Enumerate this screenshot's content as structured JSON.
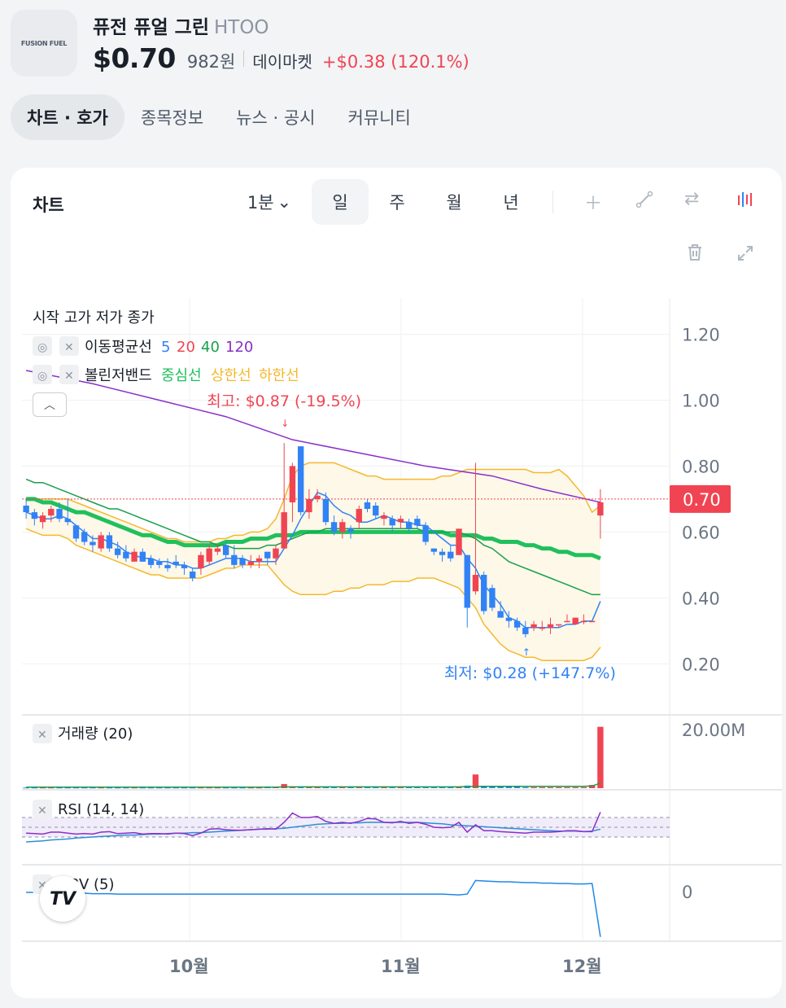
{
  "header": {
    "logo_text": "FUSION FUEL",
    "name": "퓨전 퓨얼 그린",
    "ticker": "HTOO",
    "price": "$0.70",
    "price_krw": "982원",
    "market": "데이마켓",
    "change": "+$0.38 (120.1%)",
    "change_color": "#f04452"
  },
  "tabs": [
    {
      "label": "차트 · 호가",
      "active": true
    },
    {
      "label": "종목정보"
    },
    {
      "label": "뉴스 · 공시"
    },
    {
      "label": "커뮤니티"
    }
  ],
  "chart_panel": {
    "title": "차트",
    "interval": "1분",
    "periods": [
      "일",
      "주",
      "월",
      "년"
    ],
    "active_period": "일",
    "tools": [
      "plus-icon",
      "line-draw-icon",
      "swap-icon",
      "candle-type-icon",
      "trash-icon",
      "expand-icon"
    ]
  },
  "legend": {
    "ohlc": "시작 고가 저가 종가",
    "ma_label": "이동평균선",
    "ma_periods": [
      "5",
      "20",
      "40",
      "120"
    ],
    "bb_label": "볼린저밴드",
    "bb_center": "중심선",
    "bb_upper": "상한선",
    "bb_lower": "하한선",
    "volume_label": "거래량 (20)",
    "rsi_label": "RSI (14, 14)",
    "obv_label": "OBV (5)"
  },
  "annotations": {
    "high": "최고: $0.87 (-19.5%)",
    "low": "최저: $0.28 (+147.7%)",
    "current_price": "0.70"
  },
  "colors": {
    "up": "#f04452",
    "down": "#3182f6",
    "ma5": "#3182f6",
    "ma20": "#f04452",
    "ma40": "#1a9e4b",
    "ma120": "#8b2fc9",
    "bb_center": "#20c05c",
    "bb_band": "#f5b82e"
  },
  "chart_data": {
    "type": "candlestick",
    "price_axis": {
      "ticks": [
        "1.20",
        "1.00",
        "0.80",
        "0.60",
        "0.40",
        "0.20"
      ],
      "range": [
        0.05,
        1.31
      ]
    },
    "x_axis": {
      "ticks": [
        "10월",
        "11월",
        "12월"
      ]
    },
    "volume_axis": {
      "ticks": [
        "20.00M"
      ]
    },
    "obv_axis": {
      "ticks": [
        "0"
      ]
    },
    "candles": [
      [
        0.68,
        0.7,
        0.64,
        0.66
      ],
      [
        0.66,
        0.67,
        0.62,
        0.64
      ],
      [
        0.63,
        0.66,
        0.61,
        0.65
      ],
      [
        0.65,
        0.68,
        0.63,
        0.67
      ],
      [
        0.67,
        0.69,
        0.63,
        0.64
      ],
      [
        0.64,
        0.7,
        0.62,
        0.63
      ],
      [
        0.62,
        0.62,
        0.57,
        0.58
      ],
      [
        0.6,
        0.61,
        0.56,
        0.57
      ],
      [
        0.57,
        0.59,
        0.54,
        0.56
      ],
      [
        0.55,
        0.6,
        0.54,
        0.59
      ],
      [
        0.59,
        0.6,
        0.54,
        0.55
      ],
      [
        0.55,
        0.57,
        0.52,
        0.53
      ],
      [
        0.54,
        0.56,
        0.51,
        0.52
      ],
      [
        0.51,
        0.55,
        0.51,
        0.54
      ],
      [
        0.54,
        0.55,
        0.51,
        0.51
      ],
      [
        0.52,
        0.53,
        0.49,
        0.5
      ],
      [
        0.51,
        0.52,
        0.49,
        0.5
      ],
      [
        0.5,
        0.52,
        0.48,
        0.49
      ],
      [
        0.51,
        0.53,
        0.49,
        0.5
      ],
      [
        0.5,
        0.51,
        0.47,
        0.49
      ],
      [
        0.48,
        0.49,
        0.45,
        0.46
      ],
      [
        0.49,
        0.54,
        0.47,
        0.53
      ],
      [
        0.51,
        0.56,
        0.5,
        0.55
      ],
      [
        0.54,
        0.56,
        0.53,
        0.55
      ],
      [
        0.56,
        0.57,
        0.52,
        0.53
      ],
      [
        0.53,
        0.56,
        0.49,
        0.5
      ],
      [
        0.52,
        0.53,
        0.49,
        0.5
      ],
      [
        0.5,
        0.53,
        0.49,
        0.51
      ],
      [
        0.51,
        0.53,
        0.49,
        0.52
      ],
      [
        0.54,
        0.54,
        0.5,
        0.52
      ],
      [
        0.52,
        0.56,
        0.5,
        0.55
      ],
      [
        0.55,
        0.87,
        0.55,
        0.66
      ],
      [
        0.69,
        0.81,
        0.63,
        0.8
      ],
      [
        0.86,
        0.86,
        0.65,
        0.66
      ],
      [
        0.66,
        0.73,
        0.64,
        0.7
      ],
      [
        0.7,
        0.73,
        0.69,
        0.71
      ],
      [
        0.7,
        0.72,
        0.62,
        0.63
      ],
      [
        0.63,
        0.65,
        0.59,
        0.6
      ],
      [
        0.6,
        0.64,
        0.58,
        0.63
      ],
      [
        0.61,
        0.62,
        0.58,
        0.6
      ],
      [
        0.63,
        0.68,
        0.61,
        0.67
      ],
      [
        0.69,
        0.7,
        0.66,
        0.67
      ],
      [
        0.68,
        0.69,
        0.64,
        0.65
      ],
      [
        0.64,
        0.66,
        0.62,
        0.65
      ],
      [
        0.64,
        0.65,
        0.6,
        0.62
      ],
      [
        0.63,
        0.65,
        0.61,
        0.64
      ],
      [
        0.63,
        0.64,
        0.6,
        0.61
      ],
      [
        0.64,
        0.65,
        0.61,
        0.62
      ],
      [
        0.62,
        0.63,
        0.56,
        0.57
      ],
      [
        0.55,
        0.55,
        0.53,
        0.54
      ],
      [
        0.54,
        0.55,
        0.51,
        0.53
      ],
      [
        0.54,
        0.56,
        0.51,
        0.52
      ],
      [
        0.53,
        0.61,
        0.53,
        0.61
      ],
      [
        0.53,
        0.53,
        0.31,
        0.37
      ],
      [
        0.42,
        0.81,
        0.41,
        0.47
      ],
      [
        0.47,
        0.48,
        0.35,
        0.36
      ],
      [
        0.43,
        0.44,
        0.36,
        0.37
      ],
      [
        0.36,
        0.39,
        0.34,
        0.34
      ],
      [
        0.34,
        0.36,
        0.31,
        0.33
      ],
      [
        0.33,
        0.34,
        0.3,
        0.31
      ],
      [
        0.31,
        0.33,
        0.28,
        0.29
      ],
      [
        0.31,
        0.33,
        0.3,
        0.32
      ],
      [
        0.31,
        0.33,
        0.3,
        0.31
      ],
      [
        0.31,
        0.34,
        0.29,
        0.32
      ],
      [
        0.32,
        0.32,
        0.31,
        0.32
      ],
      [
        0.33,
        0.35,
        0.33,
        0.33
      ],
      [
        0.32,
        0.34,
        0.32,
        0.34
      ],
      [
        0.33,
        0.35,
        0.32,
        0.33
      ],
      [
        0.33,
        0.33,
        0.33,
        0.33
      ],
      [
        0.65,
        0.73,
        0.58,
        0.69
      ]
    ],
    "ma5": [
      0.66,
      0.65,
      0.64,
      0.64,
      0.65,
      0.64,
      0.62,
      0.6,
      0.58,
      0.58,
      0.57,
      0.56,
      0.54,
      0.53,
      0.52,
      0.52,
      0.51,
      0.51,
      0.5,
      0.5,
      0.49,
      0.49,
      0.5,
      0.51,
      0.52,
      0.52,
      0.52,
      0.51,
      0.51,
      0.51,
      0.51,
      0.55,
      0.59,
      0.64,
      0.68,
      0.72,
      0.71,
      0.68,
      0.66,
      0.65,
      0.63,
      0.63,
      0.64,
      0.65,
      0.64,
      0.63,
      0.63,
      0.62,
      0.62,
      0.6,
      0.58,
      0.56,
      0.56,
      0.52,
      0.49,
      0.44,
      0.41,
      0.38,
      0.34,
      0.33,
      0.31,
      0.31,
      0.31,
      0.31,
      0.31,
      0.32,
      0.32,
      0.33,
      0.33,
      0.39
    ],
    "ma40": [
      0.76,
      0.75,
      0.75,
      0.74,
      0.73,
      0.72,
      0.71,
      0.7,
      0.69,
      0.68,
      0.67,
      0.67,
      0.66,
      0.65,
      0.64,
      0.63,
      0.62,
      0.61,
      0.6,
      0.59,
      0.58,
      0.57,
      0.57,
      0.56,
      0.56,
      0.55,
      0.55,
      0.55,
      0.55,
      0.56,
      0.56,
      0.57,
      0.58,
      0.59,
      0.6,
      0.6,
      0.61,
      0.61,
      0.61,
      0.61,
      0.61,
      0.61,
      0.61,
      0.61,
      0.61,
      0.61,
      0.61,
      0.61,
      0.6,
      0.6,
      0.6,
      0.6,
      0.6,
      0.59,
      0.58,
      0.56,
      0.55,
      0.53,
      0.51,
      0.5,
      0.49,
      0.48,
      0.47,
      0.46,
      0.45,
      0.44,
      0.43,
      0.42,
      0.41,
      0.41
    ],
    "bb_center": [
      0.7,
      0.7,
      0.69,
      0.69,
      0.68,
      0.67,
      0.66,
      0.66,
      0.65,
      0.64,
      0.63,
      0.62,
      0.61,
      0.6,
      0.59,
      0.59,
      0.58,
      0.57,
      0.57,
      0.56,
      0.56,
      0.56,
      0.56,
      0.56,
      0.57,
      0.57,
      0.57,
      0.58,
      0.58,
      0.58,
      0.59,
      0.59,
      0.59,
      0.6,
      0.6,
      0.6,
      0.6,
      0.6,
      0.6,
      0.6,
      0.6,
      0.6,
      0.6,
      0.6,
      0.6,
      0.6,
      0.6,
      0.6,
      0.6,
      0.6,
      0.6,
      0.59,
      0.59,
      0.59,
      0.59,
      0.58,
      0.58,
      0.57,
      0.57,
      0.57,
      0.56,
      0.56,
      0.55,
      0.55,
      0.54,
      0.54,
      0.53,
      0.53,
      0.53,
      0.52
    ],
    "bb_upper": [
      0.7,
      0.7,
      0.7,
      0.7,
      0.7,
      0.7,
      0.69,
      0.68,
      0.67,
      0.66,
      0.65,
      0.64,
      0.63,
      0.62,
      0.61,
      0.6,
      0.59,
      0.58,
      0.58,
      0.57,
      0.57,
      0.57,
      0.57,
      0.58,
      0.58,
      0.59,
      0.59,
      0.6,
      0.6,
      0.61,
      0.64,
      0.7,
      0.77,
      0.8,
      0.81,
      0.81,
      0.81,
      0.81,
      0.8,
      0.79,
      0.78,
      0.77,
      0.77,
      0.76,
      0.76,
      0.76,
      0.76,
      0.76,
      0.76,
      0.76,
      0.77,
      0.77,
      0.78,
      0.79,
      0.79,
      0.79,
      0.79,
      0.79,
      0.79,
      0.79,
      0.79,
      0.78,
      0.78,
      0.78,
      0.79,
      0.77,
      0.74,
      0.71,
      0.66,
      0.68
    ],
    "bb_lower": [
      0.61,
      0.6,
      0.59,
      0.59,
      0.59,
      0.58,
      0.56,
      0.55,
      0.54,
      0.53,
      0.52,
      0.51,
      0.5,
      0.49,
      0.48,
      0.47,
      0.47,
      0.46,
      0.46,
      0.46,
      0.46,
      0.46,
      0.47,
      0.48,
      0.49,
      0.49,
      0.5,
      0.5,
      0.5,
      0.5,
      0.47,
      0.44,
      0.42,
      0.41,
      0.41,
      0.41,
      0.41,
      0.42,
      0.42,
      0.43,
      0.43,
      0.44,
      0.44,
      0.44,
      0.45,
      0.45,
      0.45,
      0.46,
      0.46,
      0.46,
      0.45,
      0.44,
      0.43,
      0.4,
      0.37,
      0.32,
      0.29,
      0.26,
      0.24,
      0.23,
      0.22,
      0.22,
      0.21,
      0.21,
      0.21,
      0.21,
      0.21,
      0.21,
      0.22,
      0.25
    ],
    "ma120_line": [
      [
        0,
        1.09
      ],
      [
        8,
        1.05
      ],
      [
        16,
        1.0
      ],
      [
        24,
        0.95
      ],
      [
        32,
        0.88
      ],
      [
        40,
        0.84
      ],
      [
        48,
        0.8
      ],
      [
        56,
        0.77
      ],
      [
        62,
        0.73
      ],
      [
        69,
        0.69
      ]
    ],
    "volume_m": [
      0.2,
      0.2,
      0.2,
      0.2,
      0.2,
      0.2,
      0.2,
      0.2,
      0.2,
      0.2,
      0.2,
      0.2,
      0.2,
      0.2,
      0.2,
      0.2,
      0.2,
      0.2,
      0.2,
      0.2,
      0.2,
      0.2,
      0.2,
      0.2,
      0.2,
      0.2,
      0.2,
      0.2,
      0.2,
      0.3,
      0.3,
      1.3,
      0.5,
      0.4,
      0.3,
      0.3,
      0.3,
      0.3,
      0.3,
      0.3,
      0.3,
      0.3,
      0.3,
      0.3,
      0.3,
      0.3,
      0.3,
      0.3,
      0.3,
      0.3,
      0.3,
      0.3,
      0.3,
      0.8,
      4.3,
      0.6,
      0.5,
      0.4,
      0.4,
      0.4,
      0.3,
      0.3,
      0.3,
      0.3,
      0.3,
      0.3,
      0.3,
      0.3,
      1.0,
      19.3
    ],
    "volume_ma": [
      0.3,
      0.3,
      0.3,
      0.3,
      0.3,
      0.3,
      0.3,
      0.3,
      0.3,
      0.3,
      0.3,
      0.3,
      0.3,
      0.3,
      0.3,
      0.3,
      0.3,
      0.3,
      0.3,
      0.3,
      0.3,
      0.3,
      0.3,
      0.3,
      0.3,
      0.3,
      0.3,
      0.3,
      0.3,
      0.3,
      0.3,
      0.4,
      0.4,
      0.4,
      0.4,
      0.4,
      0.4,
      0.4,
      0.4,
      0.4,
      0.4,
      0.4,
      0.4,
      0.4,
      0.4,
      0.4,
      0.4,
      0.4,
      0.4,
      0.4,
      0.4,
      0.4,
      0.4,
      0.5,
      0.6,
      0.6,
      0.6,
      0.6,
      0.6,
      0.6,
      0.6,
      0.6,
      0.6,
      0.6,
      0.6,
      0.6,
      0.6,
      0.6,
      0.7,
      1.6
    ],
    "rsi": [
      38,
      37,
      36,
      40,
      40,
      38,
      36,
      37,
      36,
      40,
      41,
      37,
      38,
      39,
      36,
      37,
      37,
      36,
      38,
      37,
      33,
      38,
      46,
      47,
      45,
      44,
      44,
      45,
      46,
      47,
      46,
      60,
      79,
      70,
      70,
      72,
      62,
      58,
      60,
      58,
      62,
      68,
      67,
      60,
      59,
      62,
      58,
      60,
      56,
      50,
      49,
      50,
      60,
      40,
      55,
      43,
      43,
      41,
      40,
      39,
      38,
      40,
      40,
      40,
      41,
      43,
      43,
      41,
      41,
      81
    ],
    "rsi_signal": [
      20,
      21,
      22,
      24,
      25,
      26,
      28,
      29,
      30,
      31,
      32,
      33,
      34,
      34,
      35,
      36,
      36,
      37,
      38,
      38,
      39,
      39,
      40,
      41,
      42,
      43,
      44,
      45,
      46,
      46,
      47,
      48,
      50,
      52,
      54,
      56,
      57,
      58,
      58,
      59,
      59,
      60,
      60,
      60,
      60,
      60,
      60,
      60,
      59,
      58,
      57,
      55,
      54,
      53,
      52,
      51,
      50,
      49,
      48,
      47,
      46,
      45,
      44,
      43,
      42,
      42,
      42,
      41,
      42,
      46
    ],
    "obv": [
      0,
      0,
      0,
      0,
      -0.1,
      -0.1,
      -0.2,
      -0.2,
      -0.3,
      -0.3,
      -0.3,
      -0.4,
      -0.4,
      -0.4,
      -0.4,
      -0.4,
      -0.4,
      -0.4,
      -0.4,
      -0.4,
      -0.4,
      -0.4,
      -0.4,
      -0.4,
      -0.4,
      -0.4,
      -0.4,
      -0.4,
      -0.4,
      -0.4,
      -0.4,
      -0.4,
      -0.4,
      -0.4,
      -0.4,
      -0.4,
      -0.4,
      -0.4,
      -0.4,
      -0.4,
      -0.4,
      -0.4,
      -0.4,
      -0.4,
      -0.4,
      -0.4,
      -0.4,
      -0.4,
      -0.4,
      -0.4,
      -0.4,
      -0.5,
      -0.6,
      -0.4,
      2.8,
      2.7,
      2.6,
      2.5,
      2.5,
      2.4,
      2.3,
      2.3,
      2.2,
      2.2,
      2.1,
      2.1,
      2.0,
      2.0,
      2.1,
      -10.5
    ]
  }
}
